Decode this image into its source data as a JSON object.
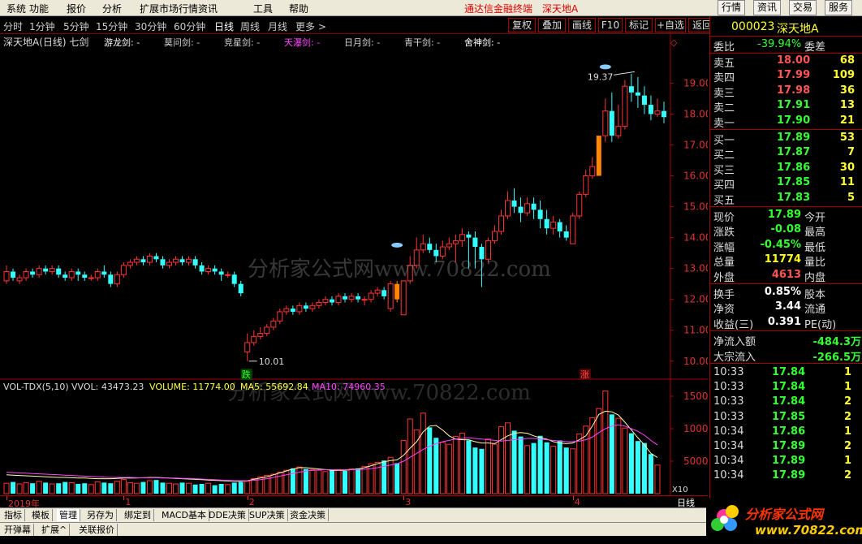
{
  "menu": {
    "items": [
      "系统",
      "功能",
      "报价",
      "分析",
      "扩展市场行情",
      "资讯",
      "工具",
      "帮助"
    ],
    "title_app": "通达信金融终端",
    "title_stock": "深天地A",
    "right_buttons": [
      "行情",
      "资讯",
      "交易",
      "服务"
    ]
  },
  "periods": [
    "分时",
    "1分钟",
    "5分钟",
    "15分钟",
    "30分钟",
    "60分钟",
    "日线",
    "周线",
    "月线",
    "更多 >"
  ],
  "active_period": "日线",
  "toolbar_buttons": [
    "复权",
    "叠加",
    "画线",
    "F10",
    "标记",
    "+自选",
    "返回"
  ],
  "chart_header": {
    "title": "深天地A(日线) 七剑",
    "indicators": [
      {
        "label": "游龙剑: -",
        "color": "#ffffff"
      },
      {
        "label": "莫问剑: -",
        "color": "#d4d4d4"
      },
      {
        "label": "竞星剑: -",
        "color": "#d4d4d4"
      },
      {
        "label": "天瀑剑: -",
        "color": "#ff44ff"
      },
      {
        "label": "日月剑: -",
        "color": "#d4d4d4"
      },
      {
        "label": "青干剑: -",
        "color": "#d4d4d4"
      },
      {
        "label": "舍神剑: -",
        "color": "#ffffff"
      }
    ]
  },
  "vol_header": {
    "name": "VOL-TDX(5,10)",
    "vvol": "VVOL: 43473.23",
    "volume": "VOLUME: 11774.00",
    "ma5": "MA5: 55692.84",
    "ma10": "MA10: 74960.35"
  },
  "annotations": {
    "high": "19.37",
    "low": "10.01",
    "die": "跌",
    "zhang": "涨",
    "x10": "X10"
  },
  "watermark": "分析家公式网www.70822.com",
  "chart_data": {
    "type": "candlestick",
    "price_axis": {
      "ticks": [
        10.0,
        11.0,
        12.0,
        13.0,
        14.0,
        15.0,
        16.0,
        17.0,
        18.0,
        19.0
      ],
      "ylim": [
        9.6,
        19.8
      ]
    },
    "volume_axis": {
      "ticks": [
        5000,
        10000,
        15000
      ],
      "ylim": [
        0,
        17000
      ]
    },
    "x_labels": [
      "2019年",
      "1",
      "2",
      "3",
      "4"
    ],
    "x_label_index": [
      0,
      18,
      37,
      61,
      87
    ],
    "candles": [
      [
        12.6,
        12.9,
        12.5,
        13.1
      ],
      [
        12.9,
        12.7,
        12.6,
        13.0
      ],
      [
        12.6,
        12.7,
        12.5,
        12.8
      ],
      [
        12.7,
        12.9,
        12.6,
        13.0
      ],
      [
        12.9,
        12.8,
        12.7,
        13.0
      ],
      [
        12.8,
        13.0,
        12.7,
        13.1
      ],
      [
        13.0,
        12.9,
        12.8,
        13.1
      ],
      [
        12.9,
        13.0,
        12.8,
        13.1
      ],
      [
        13.0,
        12.8,
        12.7,
        13.1
      ],
      [
        12.8,
        12.7,
        12.6,
        12.9
      ],
      [
        12.7,
        12.9,
        12.6,
        13.0
      ],
      [
        12.9,
        12.8,
        12.6,
        13.0
      ],
      [
        12.8,
        12.7,
        12.6,
        12.9
      ],
      [
        12.7,
        12.7,
        12.6,
        12.8
      ],
      [
        12.7,
        12.9,
        12.6,
        13.0
      ],
      [
        12.9,
        12.8,
        12.7,
        13.1
      ],
      [
        12.8,
        12.5,
        12.4,
        12.9
      ],
      [
        12.5,
        12.8,
        12.4,
        12.9
      ],
      [
        12.8,
        13.1,
        12.7,
        13.2
      ],
      [
        13.1,
        13.2,
        13.0,
        13.3
      ],
      [
        13.2,
        13.3,
        13.1,
        13.4
      ],
      [
        13.3,
        13.2,
        13.1,
        13.4
      ],
      [
        13.2,
        13.4,
        13.1,
        13.5
      ],
      [
        13.4,
        13.3,
        13.2,
        13.5
      ],
      [
        13.3,
        13.1,
        13.0,
        13.4
      ],
      [
        13.1,
        13.2,
        13.0,
        13.3
      ],
      [
        13.2,
        13.3,
        13.1,
        13.4
      ],
      [
        13.3,
        13.2,
        13.1,
        13.4
      ],
      [
        13.2,
        13.3,
        13.1,
        13.4
      ],
      [
        13.3,
        13.1,
        13.0,
        13.4
      ],
      [
        13.1,
        12.9,
        12.8,
        13.2
      ],
      [
        12.9,
        13.0,
        12.8,
        13.1
      ],
      [
        13.0,
        12.9,
        12.8,
        13.1
      ],
      [
        12.9,
        12.8,
        12.6,
        13.0
      ],
      [
        12.8,
        12.8,
        12.7,
        12.9
      ],
      [
        12.8,
        12.5,
        12.4,
        12.9
      ],
      [
        12.5,
        12.2,
        12.1,
        12.6
      ],
      [
        10.3,
        10.6,
        10.0,
        10.9
      ],
      [
        10.6,
        10.8,
        10.5,
        11.0
      ],
      [
        10.8,
        10.9,
        10.7,
        11.1
      ],
      [
        10.9,
        11.1,
        10.8,
        11.2
      ],
      [
        11.1,
        11.3,
        11.0,
        11.4
      ],
      [
        11.3,
        11.6,
        11.2,
        11.7
      ],
      [
        11.6,
        11.7,
        11.5,
        11.8
      ],
      [
        11.7,
        11.6,
        11.5,
        11.8
      ],
      [
        11.6,
        11.8,
        11.5,
        11.9
      ],
      [
        11.8,
        11.7,
        11.6,
        11.9
      ],
      [
        11.7,
        11.8,
        11.6,
        11.9
      ],
      [
        11.8,
        11.9,
        11.7,
        12.0
      ],
      [
        11.9,
        12.0,
        11.8,
        12.1
      ],
      [
        12.0,
        11.9,
        11.8,
        12.1
      ],
      [
        11.9,
        12.1,
        11.8,
        12.2
      ],
      [
        12.1,
        12.0,
        11.9,
        12.2
      ],
      [
        12.0,
        12.1,
        11.9,
        12.2
      ],
      [
        12.1,
        12.0,
        11.9,
        12.2
      ],
      [
        12.0,
        12.0,
        11.8,
        12.1
      ],
      [
        12.0,
        12.2,
        11.9,
        12.3
      ],
      [
        12.2,
        12.3,
        12.1,
        12.4
      ],
      [
        12.3,
        12.1,
        12.0,
        12.4
      ],
      [
        11.7,
        12.5,
        11.6,
        12.6
      ],
      [
        12.5,
        12.0,
        11.9,
        12.6
      ],
      [
        11.5,
        12.6,
        11.5,
        12.6
      ],
      [
        12.6,
        13.1,
        12.5,
        13.4
      ],
      [
        13.1,
        13.6,
        13.0,
        14.0
      ],
      [
        13.6,
        13.8,
        13.5,
        14.1
      ],
      [
        13.8,
        13.6,
        13.5,
        14.0
      ],
      [
        13.6,
        13.4,
        13.2,
        13.8
      ],
      [
        13.4,
        13.7,
        13.3,
        13.9
      ],
      [
        13.7,
        13.8,
        13.6,
        14.0
      ],
      [
        13.8,
        13.9,
        13.2,
        14.1
      ],
      [
        13.9,
        14.1,
        13.7,
        14.3
      ],
      [
        14.1,
        14.0,
        13.0,
        14.2
      ],
      [
        14.0,
        13.7,
        13.0,
        14.2
      ],
      [
        13.7,
        13.3,
        12.4,
        13.8
      ],
      [
        13.3,
        13.9,
        13.2,
        14.0
      ],
      [
        13.9,
        14.2,
        13.8,
        14.4
      ],
      [
        14.2,
        14.7,
        14.1,
        14.9
      ],
      [
        14.7,
        15.2,
        14.6,
        15.5
      ],
      [
        15.2,
        15.0,
        14.8,
        15.6
      ],
      [
        15.0,
        14.8,
        14.5,
        15.3
      ],
      [
        14.8,
        15.1,
        14.7,
        15.3
      ],
      [
        15.1,
        14.9,
        14.6,
        15.3
      ],
      [
        14.9,
        14.6,
        14.3,
        15.2
      ],
      [
        14.6,
        14.3,
        14.1,
        14.9
      ],
      [
        14.3,
        14.5,
        14.1,
        14.7
      ],
      [
        14.5,
        14.2,
        14.0,
        14.6
      ],
      [
        14.2,
        14.0,
        13.9,
        14.4
      ],
      [
        13.8,
        14.7,
        13.8,
        14.8
      ],
      [
        14.7,
        15.4,
        14.6,
        15.5
      ],
      [
        15.4,
        16.0,
        15.3,
        16.2
      ],
      [
        16.0,
        16.3,
        15.9,
        16.6
      ],
      [
        16.0,
        17.3,
        16.0,
        17.3
      ],
      [
        17.3,
        18.1,
        17.1,
        18.5
      ],
      [
        18.1,
        17.3,
        17.1,
        18.7
      ],
      [
        17.3,
        17.6,
        17.2,
        18.3
      ],
      [
        17.6,
        18.9,
        17.5,
        19.1
      ],
      [
        18.9,
        18.7,
        18.4,
        19.3
      ],
      [
        18.7,
        18.6,
        18.2,
        19.2
      ],
      [
        18.6,
        18.3,
        18.0,
        18.9
      ],
      [
        18.3,
        18.0,
        17.8,
        18.6
      ],
      [
        18.0,
        18.1,
        17.9,
        18.5
      ],
      [
        18.1,
        17.9,
        17.7,
        18.4
      ]
    ],
    "volume": [
      1600,
      1800,
      1500,
      1700,
      1600,
      1900,
      1700,
      1500,
      1600,
      1800,
      1700,
      1500,
      1600,
      1400,
      1800,
      1700,
      1600,
      1900,
      2200,
      1700,
      1600,
      1800,
      2000,
      2100,
      1700,
      1600,
      1500,
      1700,
      1600,
      1400,
      1500,
      1600,
      1300,
      1500,
      1400,
      1700,
      1800,
      1900,
      2300,
      2600,
      2800,
      3000,
      3300,
      3600,
      3900,
      4100,
      3800,
      3700,
      3600,
      3400,
      3600,
      3700,
      3500,
      3800,
      3900,
      4200,
      4600,
      4800,
      5100,
      5600,
      4700,
      8200,
      11500,
      9800,
      12400,
      10200,
      8600,
      7900,
      7600,
      8800,
      9300,
      8200,
      7100,
      6900,
      8400,
      7600,
      10300,
      10900,
      9700,
      8800,
      7400,
      7800,
      8900,
      7900,
      7300,
      8200,
      7100,
      6900,
      9200,
      10400,
      11700,
      13100,
      15800,
      12200,
      11600,
      10100,
      9300,
      8100,
      7800,
      6100,
      4400
    ],
    "ma5": [
      2900,
      2850,
      2800,
      2750,
      2700,
      2650,
      2600,
      2550,
      2500,
      2500,
      2450,
      2400,
      2400,
      2350,
      2300,
      2300,
      2300,
      2350,
      2400,
      2400,
      2400,
      2450,
      2500,
      2500,
      2450,
      2400,
      2350,
      2300,
      2250,
      2200,
      2150,
      2100,
      2050,
      2000,
      1950,
      1900,
      1900,
      2000,
      2200,
      2400,
      2600,
      2900,
      3200,
      3500,
      3800,
      4000,
      4000,
      3900,
      3800,
      3700,
      3600,
      3600,
      3600,
      3700,
      3800,
      4000,
      4300,
      4600,
      4900,
      5100,
      5200,
      5900,
      7000,
      8000,
      9500,
      10400,
      10500,
      9800,
      8900,
      8400,
      8300,
      8300,
      8000,
      7800,
      7800,
      7700,
      8300,
      8900,
      9300,
      9400,
      9300,
      8900,
      8600,
      8400,
      8000,
      7800,
      7700,
      7800,
      8300,
      8900,
      10400,
      12200,
      12700,
      12600,
      12100,
      11000,
      9800,
      8600,
      7500,
      6200,
      5569
    ],
    "ma10": [
      3300,
      3250,
      3200,
      3150,
      3100,
      3050,
      3000,
      2950,
      2900,
      2850,
      2800,
      2750,
      2700,
      2650,
      2600,
      2550,
      2500,
      2500,
      2500,
      2500,
      2450,
      2450,
      2450,
      2450,
      2400,
      2400,
      2400,
      2350,
      2350,
      2300,
      2250,
      2200,
      2150,
      2100,
      2050,
      2000,
      2000,
      2000,
      2050,
      2150,
      2300,
      2500,
      2700,
      2900,
      3100,
      3300,
      3500,
      3600,
      3650,
      3700,
      3700,
      3700,
      3700,
      3700,
      3700,
      3750,
      3850,
      4000,
      4200,
      4400,
      4600,
      5000,
      5600,
      6200,
      6800,
      7300,
      7700,
      8000,
      8200,
      8400,
      8500,
      8600,
      8500,
      8400,
      8300,
      8200,
      8100,
      8200,
      8300,
      8400,
      8500,
      8500,
      8400,
      8300,
      8200,
      8100,
      8000,
      8000,
      8100,
      8300,
      8700,
      9400,
      10000,
      10400,
      10600,
      10400,
      10000,
      9600,
      9000,
      8200,
      7496
    ]
  },
  "quote": {
    "code": "000023",
    "name": "深天地A",
    "weibi_label": "委比",
    "weibi": "-39.94%",
    "weicha_label": "委差",
    "asks": [
      {
        "label": "卖五",
        "price": "18.00",
        "vol": "68",
        "pc": "#ff5555"
      },
      {
        "label": "卖四",
        "price": "17.99",
        "vol": "109",
        "pc": "#ff5555"
      },
      {
        "label": "卖三",
        "price": "17.98",
        "vol": "36",
        "pc": "#ff5555"
      },
      {
        "label": "卖二",
        "price": "17.91",
        "vol": "13",
        "pc": "#33ff33"
      },
      {
        "label": "卖一",
        "price": "17.90",
        "vol": "21",
        "pc": "#33ff33"
      }
    ],
    "bids": [
      {
        "label": "买一",
        "price": "17.89",
        "vol": "53",
        "pc": "#33ff33"
      },
      {
        "label": "买二",
        "price": "17.87",
        "vol": "7",
        "pc": "#33ff33"
      },
      {
        "label": "买三",
        "price": "17.86",
        "vol": "30",
        "pc": "#33ff33"
      },
      {
        "label": "买四",
        "price": "17.85",
        "vol": "11",
        "pc": "#33ff33"
      },
      {
        "label": "买五",
        "price": "17.83",
        "vol": "5",
        "pc": "#33ff33"
      }
    ],
    "stats": [
      {
        "l": "现价",
        "v": "17.89",
        "vc": "#33ff33",
        "r": "今开"
      },
      {
        "l": "涨跌",
        "v": "-0.08",
        "vc": "#33ff33",
        "r": "最高"
      },
      {
        "l": "涨幅",
        "v": "-0.45%",
        "vc": "#33ff33",
        "r": "最低"
      },
      {
        "l": "总量",
        "v": "11774",
        "vc": "#ffff00",
        "r": "量比"
      },
      {
        "l": "外盘",
        "v": "4613",
        "vc": "#ff5555",
        "r": "内盘"
      }
    ],
    "stats2": [
      {
        "l": "换手",
        "v": "0.85%",
        "vc": "#ffffff",
        "r": "股本"
      },
      {
        "l": "净资",
        "v": "3.44",
        "vc": "#ffffff",
        "r": "流通"
      },
      {
        "l": "收益(三)",
        "v": "0.391",
        "vc": "#ffffff",
        "r": "PE(动)"
      }
    ],
    "flows": [
      {
        "l": "净流入额",
        "v": "-484.3万"
      },
      {
        "l": "大宗流入",
        "v": "-266.5万"
      }
    ],
    "ticks": [
      {
        "t": "10:33",
        "p": "17.84",
        "v": "1"
      },
      {
        "t": "10:33",
        "p": "17.84",
        "v": "1"
      },
      {
        "t": "10:33",
        "p": "17.84",
        "v": "2"
      },
      {
        "t": "10:33",
        "p": "17.85",
        "v": "2"
      },
      {
        "t": "10:34",
        "p": "17.86",
        "v": "1"
      },
      {
        "t": "10:34",
        "p": "17.89",
        "v": "2"
      },
      {
        "t": "10:34",
        "p": "17.89",
        "v": "1"
      },
      {
        "t": "10:34",
        "p": "17.89",
        "v": "2"
      }
    ]
  },
  "bottom_tabs": [
    "指标",
    "模板",
    "管理",
    "另存为",
    "绑定到",
    "MACD基本",
    "DDE决策",
    "SUP决策",
    "资金决策"
  ],
  "active_bottom_tab": "管理",
  "bottom_tabs2": [
    "开弹幕",
    "扩展^",
    "关联报价"
  ],
  "period_label": "日线",
  "logo": {
    "text": "分析家公式网",
    "url": "www.70822.com"
  }
}
